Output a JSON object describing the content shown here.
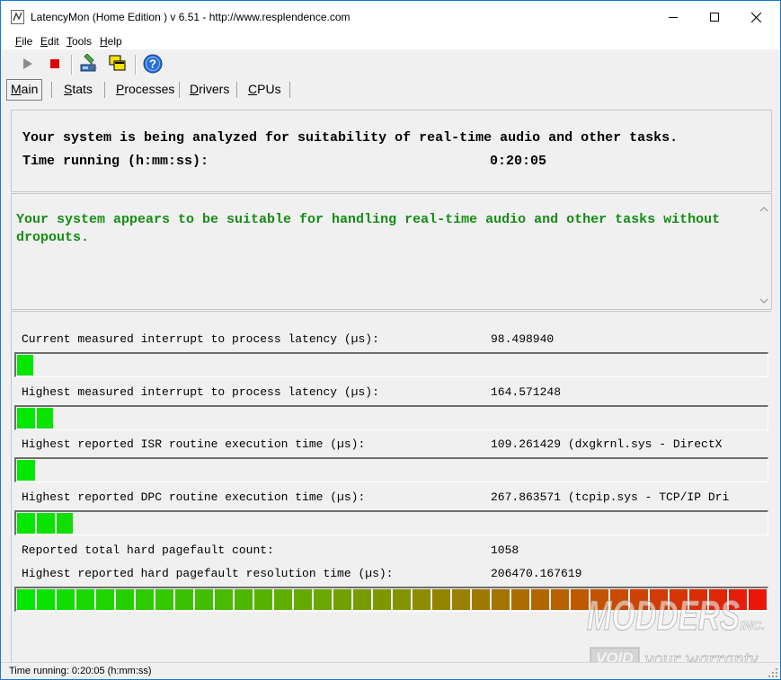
{
  "window": {
    "title": "LatencyMon  (Home Edition )  v 6.51 - http://www.resplendence.com",
    "accent": "#1979ca"
  },
  "menu": {
    "items": [
      {
        "key": "F",
        "rest": "ile"
      },
      {
        "key": "E",
        "rest": "dit"
      },
      {
        "key": "T",
        "rest": "ools"
      },
      {
        "key": "H",
        "rest": "elp"
      }
    ]
  },
  "toolbar": {
    "icons": [
      "play-icon",
      "stop-icon",
      "driver-check-icon",
      "windows-icon",
      "help-icon"
    ]
  },
  "tabs": [
    {
      "key": "M",
      "rest": "ain",
      "active": true
    },
    {
      "key": "S",
      "rest": "tats",
      "active": false
    },
    {
      "key": "P",
      "rest": "rocesses",
      "active": false
    },
    {
      "key": "D",
      "rest": "rivers",
      "active": false
    },
    {
      "key": "C",
      "rest": "PUs",
      "active": false
    }
  ],
  "summary": {
    "analyzing": "Your system is being analyzed for suitability of real-time audio and other tasks.",
    "time_label": "Time running (h:mm:ss):",
    "time_value": "0:20:05"
  },
  "verdict": {
    "text": "Your system appears to be suitable for handling real-time audio and other tasks without dropouts.",
    "color": "#148c14"
  },
  "metrics": [
    {
      "label": "Current measured interrupt to process latency (µs):",
      "value": "98.498940",
      "level": 0.022
    },
    {
      "label": "Highest measured interrupt to process latency (µs):",
      "value": "164.571248",
      "level": 0.048
    },
    {
      "label": "Highest reported ISR routine execution time (µs):",
      "value": "109.261429  (dxgkrnl.sys - DirectX",
      "level": 0.024
    },
    {
      "label": "Highest reported DPC routine execution time (µs):",
      "value": "267.863571  (tcpip.sys - TCP/IP Dri",
      "level": 0.074
    }
  ],
  "pagefault": {
    "count_label": "Reported total hard pagefault count:",
    "count_value": "1058",
    "time_label": "Highest reported hard pagefault resolution time (µs):",
    "time_value": "206470.167619",
    "level": 1.0
  },
  "status": {
    "text": "Time running: 0:20:05  (h:mm:ss)"
  },
  "watermark": {
    "brand": "MODDERS",
    "suffix": "INC.",
    "void": "VOID",
    "tagline": "your warranty"
  }
}
